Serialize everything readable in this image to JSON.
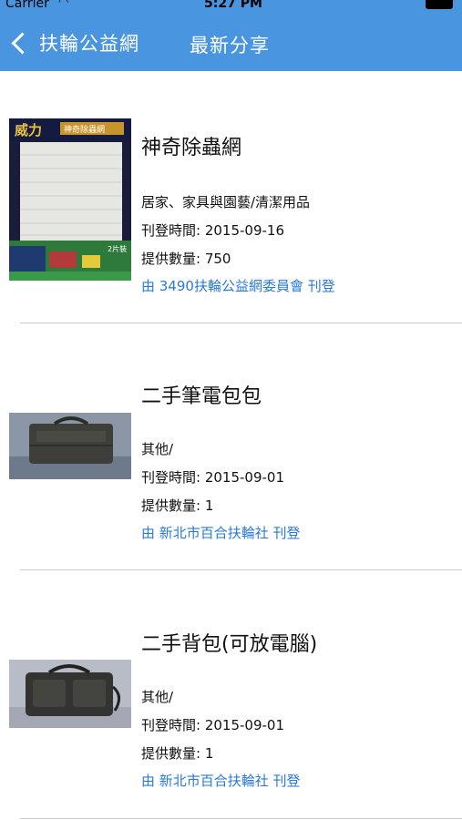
{
  "status_bar": {
    "carrier": "Carrier",
    "time": "5:27 PM"
  },
  "nav": {
    "back_label": "扶輪公益網",
    "title": "最新分享"
  },
  "items": [
    {
      "title": "神奇除蟲網",
      "category": "居家、家具與園藝/清潔用品",
      "date_label": "刊登時間:",
      "date": "2015-09-16",
      "qty_label": "提供數量:",
      "qty": "750",
      "poster": "由 3490扶輪公益網委員會 刊登",
      "thumb_text_brand": "威力",
      "thumb_text_product": "神奇除蟲網",
      "thumb_text_sub": "2片裝"
    },
    {
      "title": "二手筆電包包",
      "category": "其他/",
      "date_label": "刊登時間:",
      "date": "2015-09-01",
      "qty_label": "提供數量:",
      "qty": "1",
      "poster": "由 新北市百合扶輪社 刊登"
    },
    {
      "title": "二手背包(可放電腦)",
      "category": "其他/",
      "date_label": "刊登時間:",
      "date": "2015-09-01",
      "qty_label": "提供數量:",
      "qty": "1",
      "poster": "由 新北市百合扶輪社 刊登"
    }
  ],
  "colors": {
    "nav_bar": "#4a95e0",
    "link": "#2a7ad5",
    "separator": "#cccccc"
  }
}
